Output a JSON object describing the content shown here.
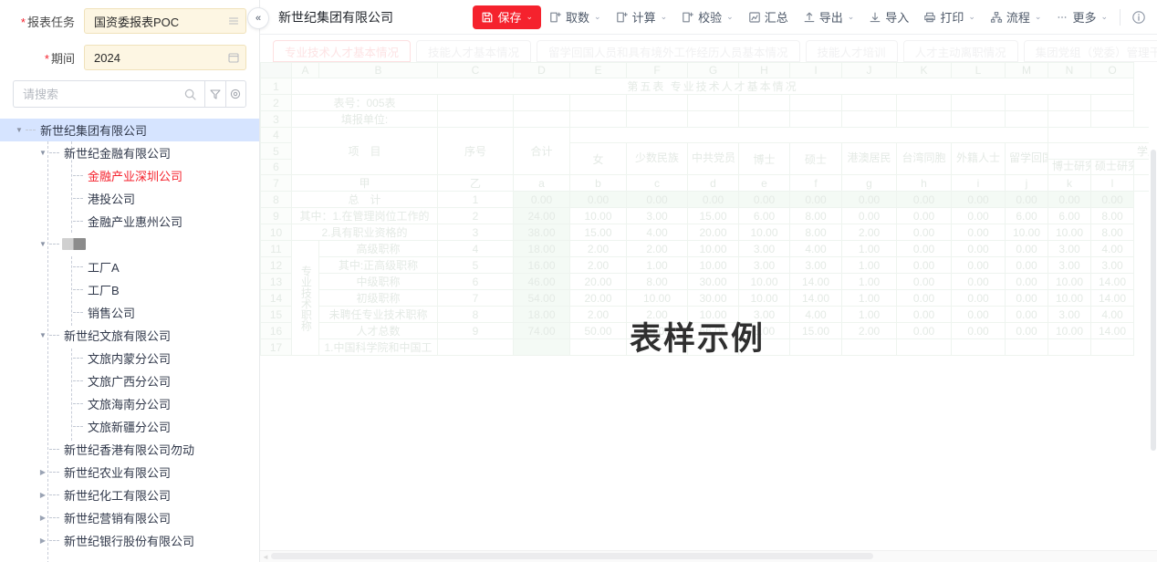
{
  "left_panel": {
    "fields": [
      {
        "label": "报表任务",
        "required": true,
        "value": "国资委报表POC",
        "icon": "list-icon"
      },
      {
        "label": "期间",
        "required": true,
        "value": "2024",
        "icon": "calendar-icon"
      }
    ],
    "search": {
      "placeholder": "请搜索",
      "value": "",
      "icons": [
        "search-icon",
        "filter-icon",
        "settings-icon"
      ]
    },
    "collapse_label": "«",
    "tree": [
      {
        "level": 0,
        "label": "新世纪集团有限公司",
        "caret": "down",
        "selected": true,
        "redacted": false,
        "red": false
      },
      {
        "level": 1,
        "label": "新世纪金融有限公司",
        "caret": "down",
        "selected": false,
        "redacted": false,
        "red": false
      },
      {
        "level": 2,
        "label": "金融产业深圳公司",
        "caret": "none",
        "selected": false,
        "redacted": false,
        "red": true
      },
      {
        "level": 2,
        "label": "港投公司",
        "caret": "none",
        "selected": false,
        "redacted": false,
        "red": false
      },
      {
        "level": 2,
        "label": "金融产业惠州公司",
        "caret": "none",
        "selected": false,
        "redacted": false,
        "red": false
      },
      {
        "level": 1,
        "label": "",
        "caret": "down",
        "selected": false,
        "redacted": true,
        "red": false
      },
      {
        "level": 2,
        "label": "工厂A",
        "caret": "none",
        "selected": false,
        "redacted": false,
        "red": false
      },
      {
        "level": 2,
        "label": "工厂B",
        "caret": "none",
        "selected": false,
        "redacted": false,
        "red": false
      },
      {
        "level": 2,
        "label": "销售公司",
        "caret": "none",
        "selected": false,
        "redacted": false,
        "red": false
      },
      {
        "level": 1,
        "label": "新世纪文旅有限公司",
        "caret": "down",
        "selected": false,
        "redacted": false,
        "red": false
      },
      {
        "level": 2,
        "label": "文旅内蒙分公司",
        "caret": "none",
        "selected": false,
        "redacted": false,
        "red": false
      },
      {
        "level": 2,
        "label": "文旅广西分公司",
        "caret": "none",
        "selected": false,
        "redacted": false,
        "red": false
      },
      {
        "level": 2,
        "label": "文旅海南分公司",
        "caret": "none",
        "selected": false,
        "redacted": false,
        "red": false
      },
      {
        "level": 2,
        "label": "文旅新疆分公司",
        "caret": "none",
        "selected": false,
        "redacted": false,
        "red": false
      },
      {
        "level": 1,
        "label": "新世纪香港有限公司勿动",
        "caret": "none",
        "selected": false,
        "redacted": false,
        "red": false
      },
      {
        "level": 1,
        "label": "新世纪农业有限公司",
        "caret": "right",
        "selected": false,
        "redacted": false,
        "red": false
      },
      {
        "level": 1,
        "label": "新世纪化工有限公司",
        "caret": "right",
        "selected": false,
        "redacted": false,
        "red": false
      },
      {
        "level": 1,
        "label": "新世纪营销有限公司",
        "caret": "right",
        "selected": false,
        "redacted": false,
        "red": false
      },
      {
        "level": 1,
        "label": "新世纪银行股份有限公司",
        "caret": "right",
        "selected": false,
        "redacted": false,
        "red": false
      }
    ]
  },
  "topbar": {
    "doc_title": "新世纪集团有限公司",
    "primary": {
      "label": "保存",
      "icon": "save-icon",
      "has_caret": true,
      "color": "#f5222d"
    },
    "actions": [
      {
        "label": "取数",
        "icon": "fetch-icon",
        "has_caret": true
      },
      {
        "label": "计算",
        "icon": "calc-icon",
        "has_caret": true
      },
      {
        "label": "校验",
        "icon": "check-icon",
        "has_caret": true
      },
      {
        "label": "汇总",
        "icon": "summary-icon",
        "has_caret": false
      },
      {
        "label": "导出",
        "icon": "export-icon",
        "has_caret": true
      },
      {
        "label": "导入",
        "icon": "import-icon",
        "has_caret": false
      },
      {
        "label": "打印",
        "icon": "print-icon",
        "has_caret": true
      },
      {
        "label": "流程",
        "icon": "flow-icon",
        "has_caret": true
      },
      {
        "label": "更多",
        "icon": "ellipsis-icon",
        "has_caret": true
      }
    ],
    "info_icon": "info-icon"
  },
  "tabs": {
    "items": [
      {
        "label": "专业技术人才基本情况",
        "active": true
      },
      {
        "label": "技能人才基本情况",
        "active": false
      },
      {
        "label": "留学回国人员和具有境外工作经历人员基本情况",
        "active": false
      },
      {
        "label": "技能人才培训",
        "active": false
      },
      {
        "label": "人才主动离职情况",
        "active": false
      },
      {
        "label": "集团党组（党委）管理干部",
        "active": false
      }
    ],
    "nav": [
      "chevron-right-icon",
      "search-icon",
      "refresh-icon"
    ]
  },
  "sheet": {
    "watermark": "表样示例",
    "column_letters": [
      "A",
      "B",
      "C",
      "D",
      "E",
      "F",
      "G",
      "H",
      "I",
      "J",
      "K",
      "L",
      "M",
      "N",
      "O"
    ],
    "row_numbers": [
      "1",
      "2",
      "3",
      "4",
      "5",
      "6",
      "7",
      "8",
      "9",
      "10",
      "11",
      "12",
      "13",
      "14",
      "15",
      "16",
      "17"
    ],
    "title": "第五表  专业技术人才基本情况",
    "meta": [
      {
        "row": "2",
        "text": "表号：005表"
      },
      {
        "row": "3",
        "text": "填报单位:"
      }
    ],
    "group_label_xueli": "学历",
    "headers_main": [
      "项　目",
      "序号",
      "合计"
    ],
    "headers_sub": [
      "女",
      "少数民族",
      "中共党员",
      "博士",
      "硕士",
      "港澳居民",
      "台湾同胞",
      "外籍人士",
      "留学回国人员",
      "博士研究生",
      "硕士研究生"
    ],
    "letter_row": [
      "甲",
      "乙",
      "a",
      "b",
      "c",
      "d",
      "e",
      "f",
      "g",
      "h",
      "i",
      "j",
      "k",
      "l"
    ],
    "vertical_group_label": "专业技术职称",
    "rows": [
      {
        "row": "8",
        "item": "总　计",
        "indent": 0,
        "seq": "1",
        "values": [
          "0.00",
          "0.00",
          "0.00",
          "0.00",
          "0.00",
          "0.00",
          "0.00",
          "0.00",
          "0.00",
          "0.00",
          "0.00",
          "0.00"
        ],
        "highlight": true
      },
      {
        "row": "9",
        "item": "其中：1.在管理岗位工作的",
        "indent": 0,
        "seq": "2",
        "values": [
          "24.00",
          "10.00",
          "3.00",
          "15.00",
          "6.00",
          "8.00",
          "0.00",
          "0.00",
          "0.00",
          "6.00",
          "6.00",
          "8.00"
        ],
        "highlight": false
      },
      {
        "row": "10",
        "item": "2.具有职业资格的",
        "indent": 1,
        "seq": "3",
        "values": [
          "38.00",
          "15.00",
          "4.00",
          "20.00",
          "10.00",
          "8.00",
          "2.00",
          "0.00",
          "0.00",
          "10.00",
          "10.00",
          "8.00"
        ],
        "highlight": false
      },
      {
        "row": "11",
        "item": "高级职称",
        "indent": 2,
        "seq": "4",
        "values": [
          "18.00",
          "2.00",
          "2.00",
          "10.00",
          "3.00",
          "4.00",
          "1.00",
          "0.00",
          "0.00",
          "0.00",
          "3.00",
          "4.00"
        ],
        "highlight": false
      },
      {
        "row": "12",
        "item": "其中:正高级职称",
        "indent": 3,
        "seq": "5",
        "values": [
          "16.00",
          "2.00",
          "1.00",
          "10.00",
          "3.00",
          "3.00",
          "1.00",
          "0.00",
          "0.00",
          "0.00",
          "3.00",
          "3.00"
        ],
        "highlight": false
      },
      {
        "row": "13",
        "item": "中级职称",
        "indent": 2,
        "seq": "6",
        "values": [
          "46.00",
          "20.00",
          "8.00",
          "30.00",
          "10.00",
          "14.00",
          "1.00",
          "0.00",
          "0.00",
          "0.00",
          "10.00",
          "14.00"
        ],
        "highlight": false
      },
      {
        "row": "14",
        "item": "初级职称",
        "indent": 2,
        "seq": "7",
        "values": [
          "54.00",
          "20.00",
          "10.00",
          "30.00",
          "10.00",
          "14.00",
          "1.00",
          "0.00",
          "0.00",
          "0.00",
          "10.00",
          "14.00"
        ],
        "highlight": false
      },
      {
        "row": "15",
        "item": "未聘任专业技术职称",
        "indent": 2,
        "seq": "8",
        "values": [
          "18.00",
          "2.00",
          "2.00",
          "10.00",
          "3.00",
          "4.00",
          "1.00",
          "0.00",
          "0.00",
          "0.00",
          "3.00",
          "4.00"
        ],
        "highlight": false
      },
      {
        "row": "16",
        "item": "人才总数",
        "indent": 2,
        "seq": "9",
        "values": [
          "74.00",
          "50.00",
          "18.00",
          "66.00",
          "6.00",
          "15.00",
          "2.00",
          "0.00",
          "0.00",
          "0.00",
          "10.00",
          "14.00"
        ],
        "highlight": false
      },
      {
        "row": "17",
        "item": "1.中国科学院和中国工",
        "indent": 2,
        "seq": "",
        "values": [
          "",
          "",
          "",
          "",
          "",
          "",
          "",
          "",
          "",
          "",
          "",
          ""
        ],
        "highlight": false
      }
    ]
  }
}
